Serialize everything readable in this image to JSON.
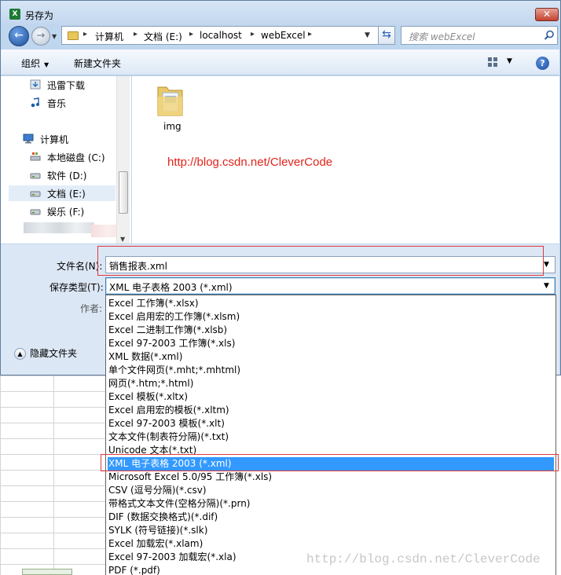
{
  "window": {
    "title": "另存为",
    "app_badge": "X",
    "close_glyph": "✕"
  },
  "address": {
    "segments": [
      "计算机",
      "文档 (E:)",
      "localhost",
      "webExcel"
    ],
    "separator": "▸"
  },
  "search": {
    "placeholder": "搜索 webExcel"
  },
  "toolbar": {
    "organize_label": "组织",
    "new_folder_label": "新建文件夹",
    "help_glyph": "?"
  },
  "nav": {
    "items": [
      {
        "label": "迅雷下载",
        "icon": "download-folder-icon"
      },
      {
        "label": "音乐",
        "icon": "music-icon"
      },
      {
        "label": "计算机",
        "icon": "computer-icon"
      },
      {
        "label": "本地磁盘 (C:)",
        "icon": "system-drive-icon"
      },
      {
        "label": "软件 (D:)",
        "icon": "drive-icon"
      },
      {
        "label": "文档 (E:)",
        "icon": "drive-icon",
        "selected": true
      },
      {
        "label": "娱乐 (F:)",
        "icon": "drive-icon"
      }
    ]
  },
  "main": {
    "folders": [
      {
        "label": "img",
        "icon": "folder-icon"
      }
    ],
    "watermark": "http://blog.csdn.net/CleverCode"
  },
  "form": {
    "filename_label": "文件名(N):",
    "filename_value": "销售报表.xml",
    "type_label": "保存类型(T):",
    "type_value": "XML 电子表格 2003 (*.xml)",
    "author_label": "作者:",
    "hide_folders_label": "隐藏文件夹"
  },
  "type_options": [
    "Excel 工作簿(*.xlsx)",
    "Excel 启用宏的工作簿(*.xlsm)",
    "Excel 二进制工作簿(*.xlsb)",
    "Excel 97-2003 工作簿(*.xls)",
    "XML 数据(*.xml)",
    "单个文件网页(*.mht;*.mhtml)",
    "网页(*.htm;*.html)",
    "Excel 模板(*.xltx)",
    "Excel 启用宏的模板(*.xltm)",
    "Excel 97-2003 模板(*.xlt)",
    "文本文件(制表符分隔)(*.txt)",
    "Unicode 文本(*.txt)",
    "XML 电子表格 2003 (*.xml)",
    "Microsoft Excel 5.0/95 工作簿(*.xls)",
    "CSV (逗号分隔)(*.csv)",
    "带格式文本文件(空格分隔)(*.prn)",
    "DIF (数据交换格式)(*.dif)",
    "SYLK (符号链接)(*.slk)",
    "Excel 加载宏(*.xlam)",
    "Excel 97-2003 加载宏(*.xla)",
    "PDF (*.pdf)"
  ],
  "selected_type_index": 12,
  "footer_watermark": "http://blog.csdn.net/CleverCode",
  "colors": {
    "accent": "#3399ff",
    "highlight_border": "#e0393e",
    "watermark_red": "#e2231a"
  }
}
